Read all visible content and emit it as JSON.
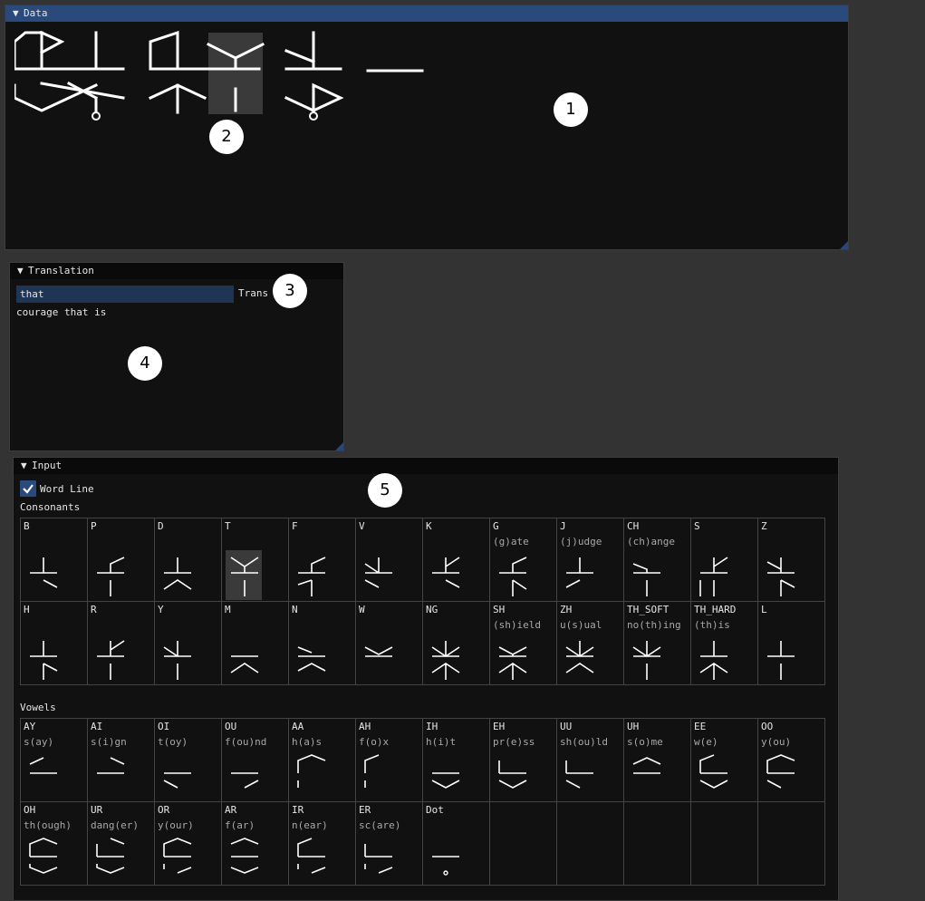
{
  "data_window": {
    "title": "Data"
  },
  "translation_window": {
    "title": "Translation",
    "input_value": "that",
    "button_label": "Trans",
    "output": "courage that is"
  },
  "input_window": {
    "title": "Input",
    "word_line_label": "Word Line",
    "word_line_checked": true,
    "consonants_label": "Consonants",
    "vowels_label": "Vowels",
    "consonants": [
      {
        "name": "B",
        "ex": ""
      },
      {
        "name": "P",
        "ex": ""
      },
      {
        "name": "D",
        "ex": ""
      },
      {
        "name": "T",
        "ex": ""
      },
      {
        "name": "F",
        "ex": ""
      },
      {
        "name": "V",
        "ex": ""
      },
      {
        "name": "K",
        "ex": ""
      },
      {
        "name": "G",
        "ex": "(g)ate"
      },
      {
        "name": "J",
        "ex": "(j)udge"
      },
      {
        "name": "CH",
        "ex": "(ch)ange"
      },
      {
        "name": "S",
        "ex": ""
      },
      {
        "name": "Z",
        "ex": ""
      },
      {
        "name": "H",
        "ex": ""
      },
      {
        "name": "R",
        "ex": ""
      },
      {
        "name": "Y",
        "ex": ""
      },
      {
        "name": "M",
        "ex": ""
      },
      {
        "name": "N",
        "ex": ""
      },
      {
        "name": "W",
        "ex": ""
      },
      {
        "name": "NG",
        "ex": ""
      },
      {
        "name": "SH",
        "ex": "(sh)ield"
      },
      {
        "name": "ZH",
        "ex": "u(s)ual"
      },
      {
        "name": "TH_SOFT",
        "ex": "no(th)ing"
      },
      {
        "name": "TH_HARD",
        "ex": "(th)is"
      },
      {
        "name": "L",
        "ex": ""
      }
    ],
    "vowels": [
      {
        "name": "AY",
        "ex": "s(ay)"
      },
      {
        "name": "AI",
        "ex": "s(i)gn"
      },
      {
        "name": "OI",
        "ex": "t(oy)"
      },
      {
        "name": "OU",
        "ex": "f(ou)nd"
      },
      {
        "name": "AA",
        "ex": "h(a)s"
      },
      {
        "name": "AH",
        "ex": "f(o)x"
      },
      {
        "name": "IH",
        "ex": "h(i)t"
      },
      {
        "name": "EH",
        "ex": "pr(e)ss"
      },
      {
        "name": "UU",
        "ex": "sh(ou)ld"
      },
      {
        "name": "UH",
        "ex": "s(o)me"
      },
      {
        "name": "EE",
        "ex": "w(e)"
      },
      {
        "name": "OO",
        "ex": "y(ou)"
      },
      {
        "name": "OH",
        "ex": "th(ough)"
      },
      {
        "name": "UR",
        "ex": "dang(er)"
      },
      {
        "name": "OR",
        "ex": "y(our)"
      },
      {
        "name": "AR",
        "ex": "f(ar)"
      },
      {
        "name": "IR",
        "ex": "n(ear)"
      },
      {
        "name": "ER",
        "ex": "sc(are)"
      },
      {
        "name": "Dot",
        "ex": ""
      },
      {
        "name": "",
        "ex": ""
      },
      {
        "name": "",
        "ex": ""
      },
      {
        "name": "",
        "ex": ""
      },
      {
        "name": "",
        "ex": ""
      },
      {
        "name": "",
        "ex": ""
      }
    ]
  },
  "annotations": [
    "1",
    "2",
    "3",
    "4",
    "5"
  ],
  "colors": {
    "title_active": "#294a7a",
    "window_bg": "#111111",
    "desktop": "#333333",
    "glyph": "#ffffff"
  }
}
